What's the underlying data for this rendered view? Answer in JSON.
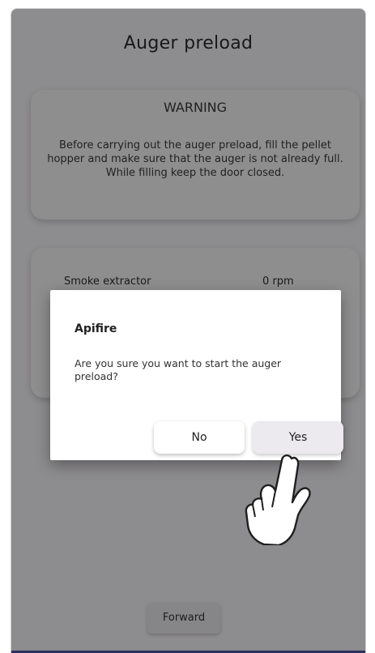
{
  "screen": {
    "title": "Auger preload",
    "warning": {
      "title": "WARNING",
      "text": "Before carrying out the auger preload, fill the pellet hopper and make sure that the auger is not already full. While filling keep the door closed."
    },
    "status": {
      "label": "Smoke extractor",
      "value": "0 rpm"
    },
    "forward_label": "Forward"
  },
  "dialog": {
    "title": "Apifire",
    "message": "Are you sure you want to start the auger preload?",
    "no_label": "No",
    "yes_label": "Yes"
  },
  "pointer": {
    "icon": "pointing-hand-icon"
  },
  "colors": {
    "background": "#f3f1f4",
    "accent": "#4b56a8",
    "overlay": "rgba(0,0,0,0.42)"
  }
}
